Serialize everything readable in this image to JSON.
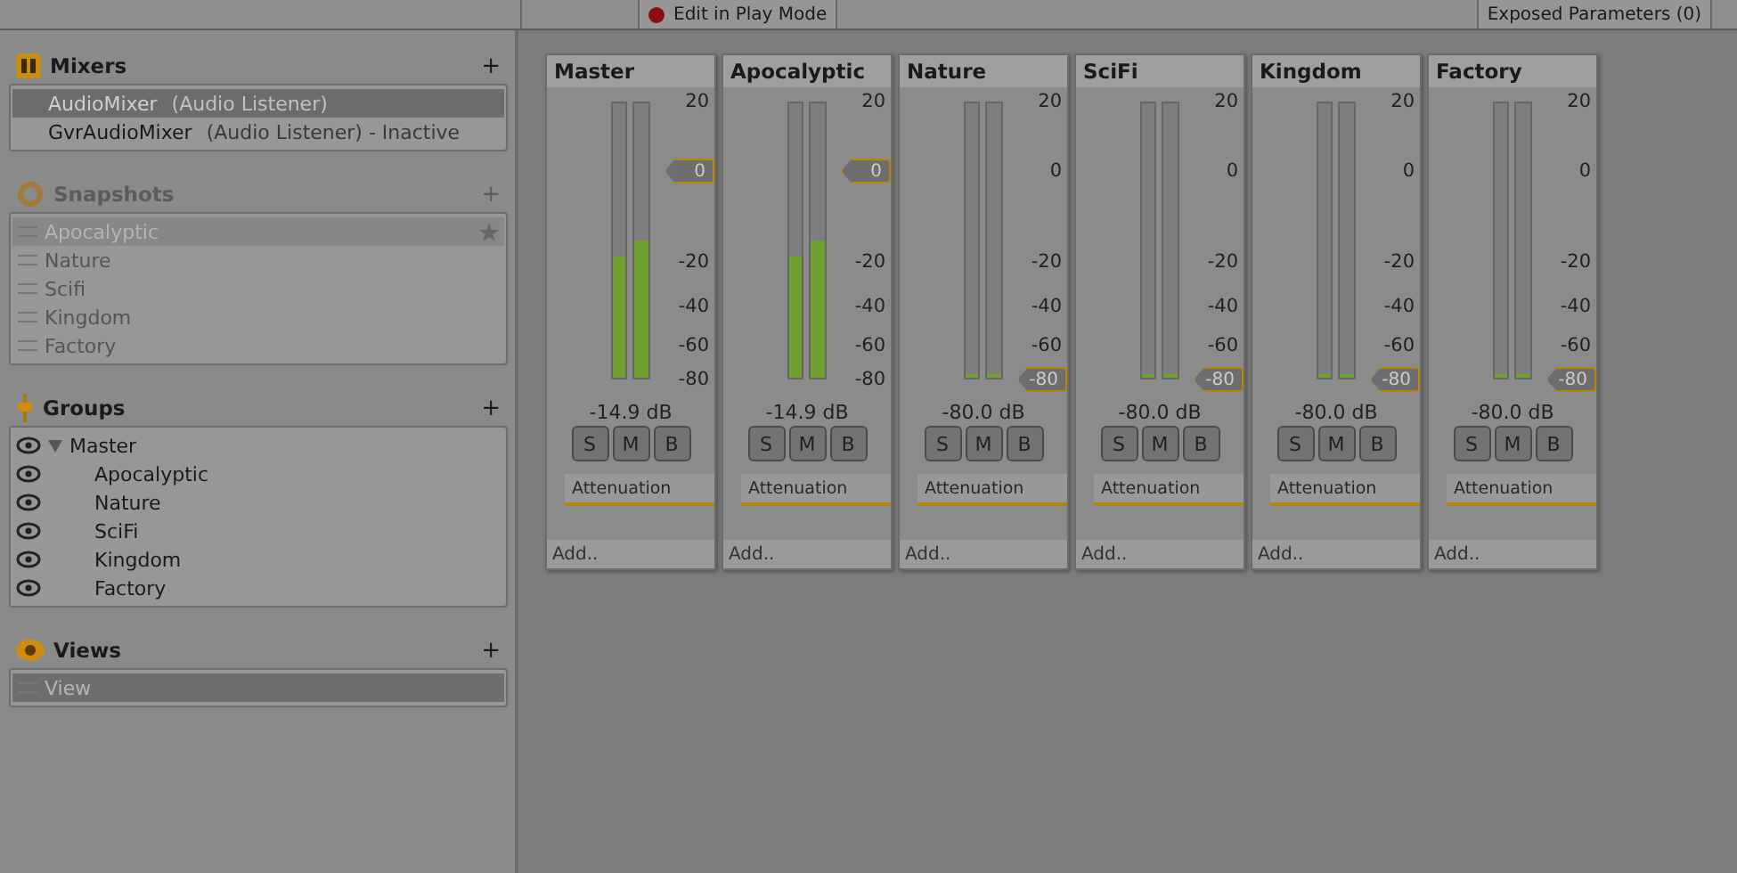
{
  "toolbar": {
    "play_mode_button": "Edit in Play Mode",
    "exposed_parameters": "Exposed Parameters (0)"
  },
  "sidebar": {
    "mixers": {
      "title": "Mixers",
      "add": "+",
      "items": [
        {
          "name": "AudioMixer",
          "suffix": "(Audio Listener)",
          "selected": true
        },
        {
          "name": "GvrAudioMixer",
          "suffix": "(Audio Listener) - Inactive",
          "selected": false
        }
      ]
    },
    "snapshots": {
      "title": "Snapshots",
      "add": "+",
      "items": [
        {
          "name": "Apocalyptic",
          "selected": true,
          "starred": true
        },
        {
          "name": "Nature",
          "selected": false,
          "starred": false
        },
        {
          "name": "Scifi",
          "selected": false,
          "starred": false
        },
        {
          "name": "Kingdom",
          "selected": false,
          "starred": false
        },
        {
          "name": "Factory",
          "selected": false,
          "starred": false
        }
      ]
    },
    "groups": {
      "title": "Groups",
      "add": "+",
      "items": [
        {
          "name": "Master",
          "expanded": true,
          "children": [
            {
              "name": "Apocalyptic"
            },
            {
              "name": "Nature"
            },
            {
              "name": "SciFi"
            },
            {
              "name": "Kingdom"
            },
            {
              "name": "Factory"
            }
          ]
        }
      ]
    },
    "views": {
      "title": "Views",
      "add": "+",
      "items": [
        {
          "name": "View",
          "selected": true
        }
      ]
    }
  },
  "strips": [
    {
      "name": "Master",
      "meters": [
        {
          "level": 0.44
        },
        {
          "level": 0.5
        }
      ],
      "reading": "-14.9 dB",
      "buttons": [
        "S",
        "M",
        "B"
      ],
      "effect": "Attenuation",
      "add": "Add..",
      "scale": [
        {
          "kind": "tick",
          "label": "20"
        },
        {
          "kind": "fader",
          "label": "0"
        },
        {
          "kind": "tick",
          "label": "-20"
        },
        {
          "kind": "tick",
          "label": "-40"
        },
        {
          "kind": "tick",
          "label": "-60"
        },
        {
          "kind": "tick",
          "label": "-80"
        }
      ]
    },
    {
      "name": "Apocalyptic",
      "meters": [
        {
          "level": 0.44
        },
        {
          "level": 0.5
        }
      ],
      "reading": "-14.9 dB",
      "buttons": [
        "S",
        "M",
        "B"
      ],
      "effect": "Attenuation",
      "add": "Add..",
      "scale": [
        {
          "kind": "tick",
          "label": "20"
        },
        {
          "kind": "fader",
          "label": "0"
        },
        {
          "kind": "tick",
          "label": "-20"
        },
        {
          "kind": "tick",
          "label": "-40"
        },
        {
          "kind": "tick",
          "label": "-60"
        },
        {
          "kind": "tick",
          "label": "-80"
        }
      ]
    },
    {
      "name": "Nature",
      "meters": [
        {
          "level": 0.01
        },
        {
          "level": 0.01
        }
      ],
      "reading": "-80.0 dB",
      "buttons": [
        "S",
        "M",
        "B"
      ],
      "effect": "Attenuation",
      "add": "Add..",
      "scale": [
        {
          "kind": "tick",
          "label": "20"
        },
        {
          "kind": "tick",
          "label": "0"
        },
        {
          "kind": "tick",
          "label": "-20"
        },
        {
          "kind": "tick",
          "label": "-40"
        },
        {
          "kind": "tick",
          "label": "-60"
        },
        {
          "kind": "fader",
          "label": "-80"
        }
      ]
    },
    {
      "name": "SciFi",
      "meters": [
        {
          "level": 0.01
        },
        {
          "level": 0.01
        }
      ],
      "reading": "-80.0 dB",
      "buttons": [
        "S",
        "M",
        "B"
      ],
      "effect": "Attenuation",
      "add": "Add..",
      "scale": [
        {
          "kind": "tick",
          "label": "20"
        },
        {
          "kind": "tick",
          "label": "0"
        },
        {
          "kind": "tick",
          "label": "-20"
        },
        {
          "kind": "tick",
          "label": "-40"
        },
        {
          "kind": "tick",
          "label": "-60"
        },
        {
          "kind": "fader",
          "label": "-80"
        }
      ]
    },
    {
      "name": "Kingdom",
      "meters": [
        {
          "level": 0.01
        },
        {
          "level": 0.01
        }
      ],
      "reading": "-80.0 dB",
      "buttons": [
        "S",
        "M",
        "B"
      ],
      "effect": "Attenuation",
      "add": "Add..",
      "scale": [
        {
          "kind": "tick",
          "label": "20"
        },
        {
          "kind": "tick",
          "label": "0"
        },
        {
          "kind": "tick",
          "label": "-20"
        },
        {
          "kind": "tick",
          "label": "-40"
        },
        {
          "kind": "tick",
          "label": "-60"
        },
        {
          "kind": "fader",
          "label": "-80"
        }
      ]
    },
    {
      "name": "Factory",
      "meters": [
        {
          "level": 0.01
        },
        {
          "level": 0.01
        }
      ],
      "reading": "-80.0 dB",
      "buttons": [
        "S",
        "M",
        "B"
      ],
      "effect": "Attenuation",
      "add": "Add..",
      "scale": [
        {
          "kind": "tick",
          "label": "20"
        },
        {
          "kind": "tick",
          "label": "0"
        },
        {
          "kind": "tick",
          "label": "-20"
        },
        {
          "kind": "tick",
          "label": "-40"
        },
        {
          "kind": "tick",
          "label": "-60"
        },
        {
          "kind": "fader",
          "label": "-80"
        }
      ]
    }
  ]
}
